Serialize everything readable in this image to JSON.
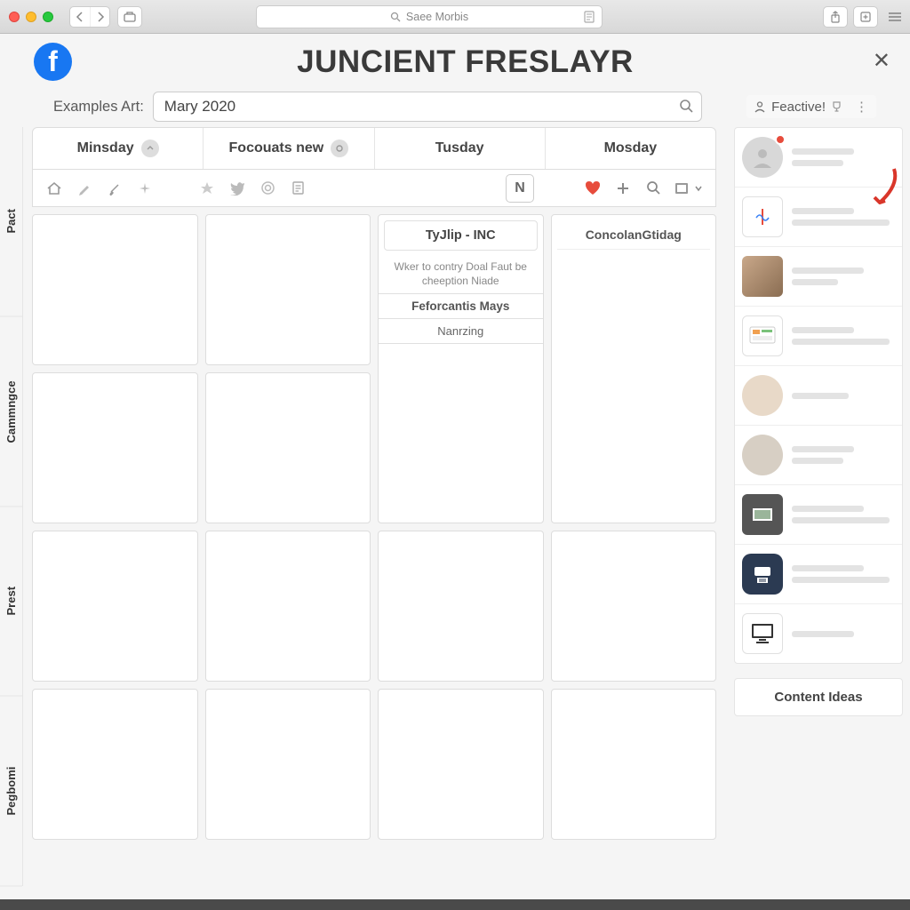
{
  "browser": {
    "address_text": "Saee Morbis"
  },
  "app": {
    "title": "JUNCIENT FRESLAYR",
    "search_label": "Examples Art:",
    "search_value": "Mary 2020",
    "feactive_label": "Feactive!"
  },
  "tabs": [
    {
      "label": "Minsday"
    },
    {
      "label": "Focouats new"
    },
    {
      "label": "Tusday"
    },
    {
      "label": "Mosday"
    }
  ],
  "toolbar": {
    "n_label": "N"
  },
  "cells": {
    "col3": {
      "head": "TyJlip - INC",
      "desc": "Wker to contry Doal Faut be cheeption Niade",
      "sub": "Feforcantis Mays",
      "tag": "Nanrzing"
    },
    "col4": {
      "head": "ConcolanGtidag"
    }
  },
  "left_rail": [
    "Pact",
    "Cammngce",
    "Prest",
    "Pegbomi"
  ],
  "sidebar": {
    "content_ideas": "Content Ideas"
  }
}
